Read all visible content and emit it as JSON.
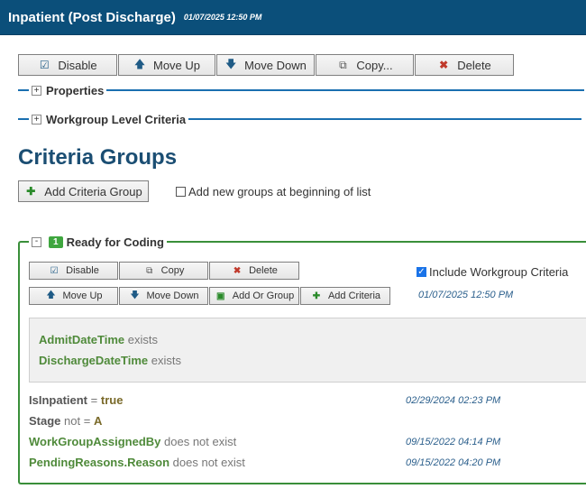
{
  "header": {
    "title": "Inpatient (Post Discharge)",
    "date": "01/07/2025 12:50 PM"
  },
  "toolbar": {
    "disable": "Disable",
    "move_up": "Move Up",
    "move_down": "Move Down",
    "copy": "Copy...",
    "delete": "Delete"
  },
  "sections": {
    "properties": "Properties",
    "workgroup_level": "Workgroup Level Criteria"
  },
  "criteria_groups": {
    "title": "Criteria Groups",
    "add_button": "Add Criteria Group",
    "add_at_beginning": "Add new groups at beginning of list"
  },
  "group": {
    "badge": "1",
    "name": "Ready for Coding",
    "buttons": {
      "disable": "Disable",
      "copy": "Copy",
      "delete": "Delete",
      "move_up": "Move Up",
      "move_down": "Move Down",
      "add_or_group": "Add Or Group",
      "add_criteria": "Add Criteria"
    },
    "include_workgroup": "Include Workgroup Criteria",
    "date": "01/07/2025 12:50 PM",
    "or_criteria": [
      {
        "field": "AdmitDateTime",
        "op": "exists"
      },
      {
        "field": "DischargeDateTime",
        "op": "exists"
      }
    ],
    "criteria": [
      {
        "field": "IsInpatient",
        "op": "=",
        "value": "true",
        "date": "02/29/2024 02:23 PM"
      },
      {
        "field": "Stage",
        "op": "not =",
        "value": "A",
        "date": ""
      },
      {
        "field": "WorkGroupAssignedBy",
        "op": "does not exist",
        "value": "",
        "date": "09/15/2022 04:14 PM"
      },
      {
        "field": "PendingReasons.Reason",
        "op": "does not exist",
        "value": "",
        "date": "09/15/2022 04:20 PM"
      }
    ]
  }
}
